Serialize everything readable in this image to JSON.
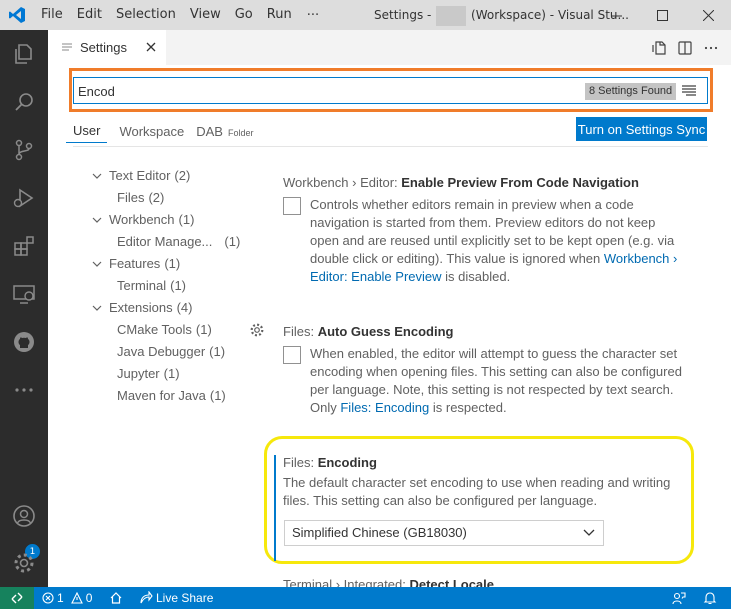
{
  "colors": {
    "accent": "#007acc",
    "search_highlight": "#f07c2a",
    "focus_highlight": "#f6e80c",
    "remote_indicator": "#16825d",
    "activity_bar": "#2c2c2c",
    "title_bar": "#dddddd"
  },
  "titlebar": {
    "app_icon": "vscode-logo-icon",
    "menus": [
      "File",
      "Edit",
      "Selection",
      "View",
      "Go",
      "Run"
    ],
    "menu_overflow": "···",
    "title_prefix": "Settings -",
    "title_suffix": "(Workspace) - Visual Stu..."
  },
  "activity_bar": {
    "icons": [
      "explorer-icon",
      "search-icon",
      "source-control-icon",
      "run-debug-icon",
      "extensions-icon",
      "remote-explorer-icon",
      "github-icon",
      "more-icon",
      "accounts-icon",
      "manage-gear-icon"
    ],
    "accounts_badge": "1"
  },
  "tab": {
    "label": "Settings"
  },
  "search": {
    "value": "Encod",
    "results_badge": "8 Settings Found"
  },
  "scope_tabs": {
    "user": "User",
    "workspace": "Workspace",
    "folder": "DAB",
    "folder_hint": "Folder"
  },
  "sync_button": "Turn on Settings Sync",
  "toc": [
    {
      "label": "Text Editor",
      "count": "(2)",
      "level": 1
    },
    {
      "label": "Files",
      "count": "(2)",
      "level": 2
    },
    {
      "label": "Workbench",
      "count": "(1)",
      "level": 1
    },
    {
      "label": "Editor Manage...",
      "count": "(1)",
      "level": 2
    },
    {
      "label": "Features",
      "count": "(1)",
      "level": 1
    },
    {
      "label": "Terminal",
      "count": "(1)",
      "level": 2
    },
    {
      "label": "Extensions",
      "count": "(4)",
      "level": 1
    },
    {
      "label": "CMake Tools",
      "count": "(1)",
      "level": 2
    },
    {
      "label": "Java Debugger",
      "count": "(1)",
      "level": 2
    },
    {
      "label": "Jupyter",
      "count": "(1)",
      "level": 2
    },
    {
      "label": "Maven for Java",
      "count": "(1)",
      "level": 2
    }
  ],
  "settings": {
    "preview": {
      "category": "Workbench › Editor:",
      "name": "Enable Preview From Code Navigation",
      "desc_1": "Controls whether editors remain in preview when a code navigation is started from them. Preview editors do not keep open and are reused until explicitly set to be kept open (e.g. via double click or editing). This value is ignored when",
      "link": "Workbench › Editor: Enable Preview",
      "desc_2": "is disabled."
    },
    "guess": {
      "category": "Files:",
      "name": "Auto Guess Encoding",
      "desc_1": "When enabled, the editor will attempt to guess the character set encoding when opening files. This setting can also be configured per language. Note, this setting is not respected by text search. Only",
      "link": "Files: Encoding",
      "desc_2": "is respected."
    },
    "encoding": {
      "category": "Files:",
      "name": "Encoding",
      "description": "The default character set encoding to use when reading and writing files. This setting can also be configured per language.",
      "selected": "Simplified Chinese (GB18030)"
    },
    "next": {
      "category": "Terminal › Integrated:",
      "name": "Detect Locale"
    }
  },
  "statusbar": {
    "errors": "1",
    "warnings": "0",
    "live_share": "Live Share"
  }
}
